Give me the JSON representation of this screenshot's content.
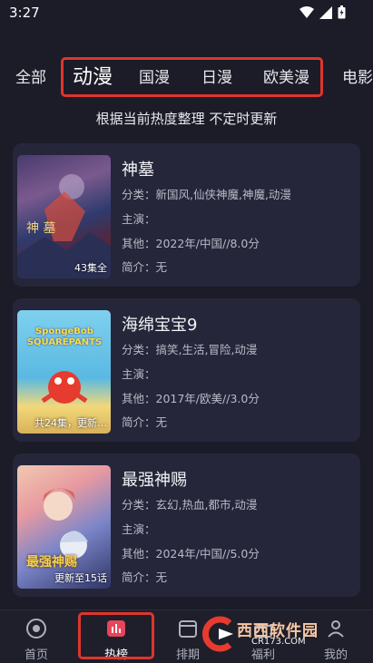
{
  "status_bar": {
    "time": "3:27"
  },
  "tabs": [
    {
      "label": "全部"
    },
    {
      "label": "动漫"
    },
    {
      "label": "国漫"
    },
    {
      "label": "日漫"
    },
    {
      "label": "欧美漫"
    },
    {
      "label": "电影"
    }
  ],
  "subtitle": "根据当前热度整理 不定时更新",
  "items": [
    {
      "title": "神墓",
      "category": "分类：新国风,仙侠神魔,神魔,动漫",
      "cast": "主演：",
      "other": "其他：2022年/中国//8.0分",
      "intro": "简介：无",
      "badge": "43集全",
      "poster_logo": "神 墓"
    },
    {
      "title": "海绵宝宝9",
      "category": "分类：搞笑,生活,冒险,动漫",
      "cast": "主演：",
      "other": "其他：2017年/欧美//3.0分",
      "intro": "简介：无",
      "badge": "共24集，更新…",
      "poster_logo": "SpongeBob SQUAREPANTS"
    },
    {
      "title": "最强神赐",
      "category": "分类：玄幻,热血,都市,动漫",
      "cast": "主演：",
      "other": "其他：2024年/中国//5.0分",
      "intro": "简介：无",
      "badge": "更新至15话",
      "poster_logo": "最强神赐"
    }
  ],
  "bottom_nav": [
    {
      "label": "首页",
      "icon": "home-icon"
    },
    {
      "label": "热榜",
      "icon": "chart-icon"
    },
    {
      "label": "排期",
      "icon": "calendar-icon"
    },
    {
      "label": "福利",
      "icon": "gift-icon"
    },
    {
      "label": "我的",
      "icon": "profile-icon"
    }
  ],
  "watermark": {
    "title": "西西软件园",
    "subtitle": "CR173.COM"
  },
  "colors": {
    "highlight": "#e0352b",
    "background": "#1b1c27",
    "card": "#25263a"
  }
}
